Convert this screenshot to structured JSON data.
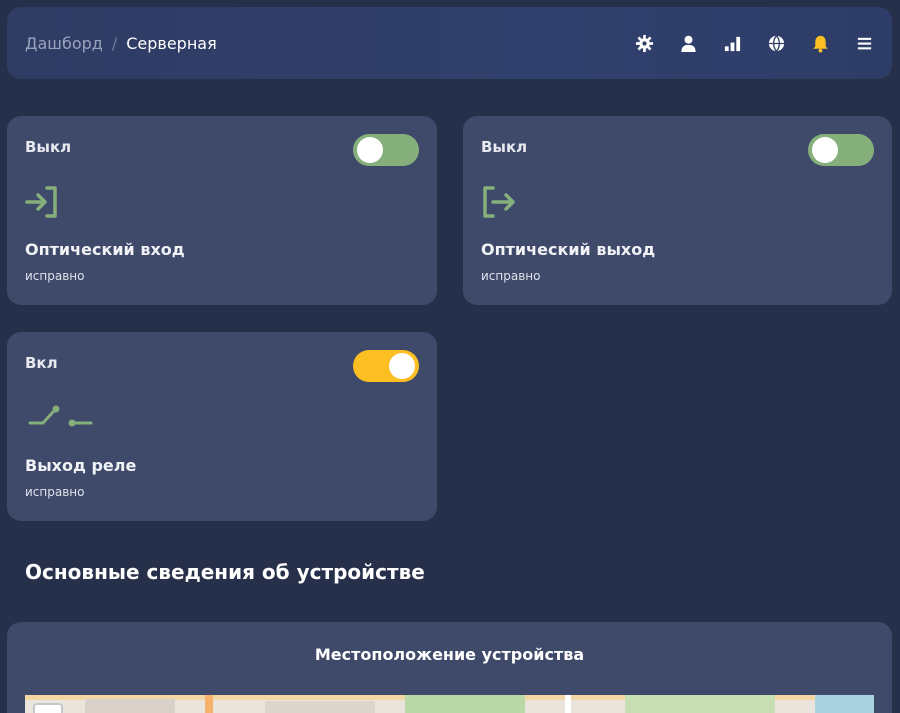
{
  "header": {
    "breadcrumb_root": "Дашборд",
    "breadcrumb_separator": "/",
    "breadcrumb_current": "Серверная",
    "icons": [
      "settings-icon",
      "user-icon",
      "signal-icon",
      "globe-icon",
      "bell-icon",
      "menu-icon"
    ],
    "bell_color": "#fbbf24"
  },
  "cards": [
    {
      "state": "Выкл",
      "title": "Оптический вход",
      "status": "исправно",
      "toggle": false,
      "icon": "login-icon"
    },
    {
      "state": "Выкл",
      "title": "Оптический выход",
      "status": "исправно",
      "toggle": false,
      "icon": "logout-icon"
    },
    {
      "state": "Вкл",
      "title": "Выход реле",
      "status": "исправно",
      "toggle": true,
      "icon": "relay-icon"
    }
  ],
  "section": {
    "title": "Основные сведения об устройстве"
  },
  "map_card": {
    "title": "Местоположение устройства"
  },
  "colors": {
    "background": "#27304a",
    "card": "#3f4a6a",
    "toggle_off": "#86b07b",
    "toggle_on": "#fbbf24",
    "icon_green": "#86b07b"
  }
}
